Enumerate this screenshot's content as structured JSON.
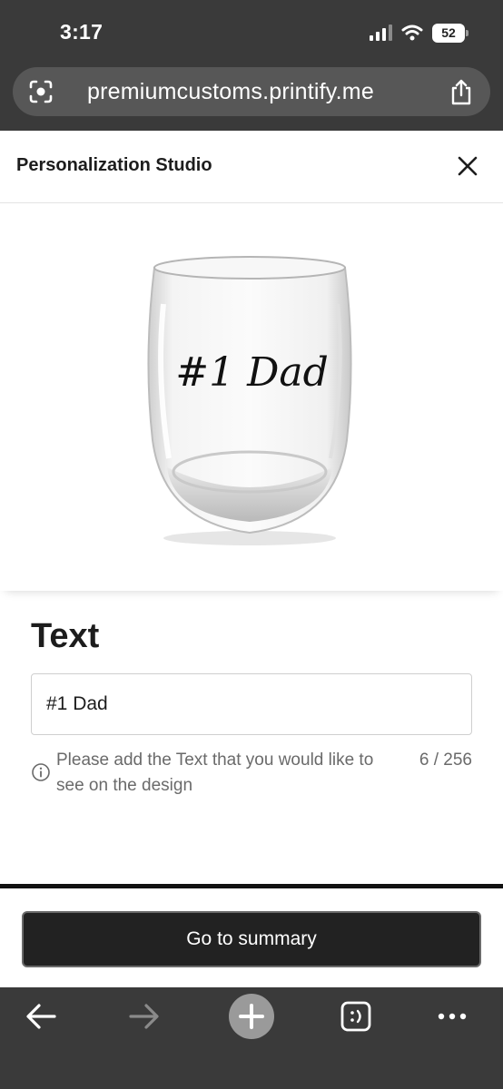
{
  "status_bar": {
    "time": "3:17",
    "battery": "52"
  },
  "browser": {
    "url": "premiumcustoms.printify.me"
  },
  "studio": {
    "title": "Personalization Studio"
  },
  "preview": {
    "glass_text": "#1 Dad"
  },
  "text_section": {
    "title": "Text",
    "input_value": "#1 Dad",
    "help_text": "Please add the Text that you would like to see on the design",
    "char_count": "6 / 256"
  },
  "footer": {
    "summary_button": "Go to summary"
  },
  "icons": {
    "status": [
      "signal-icon",
      "wifi-icon",
      "battery-icon"
    ],
    "url_bar": [
      "lens-icon",
      "share-icon"
    ],
    "header": [
      "close-icon"
    ],
    "help": [
      "info-icon"
    ],
    "toolbar": [
      "back-arrow-icon",
      "forward-arrow-icon",
      "plus-icon",
      "tabs-icon",
      "more-icon"
    ]
  }
}
